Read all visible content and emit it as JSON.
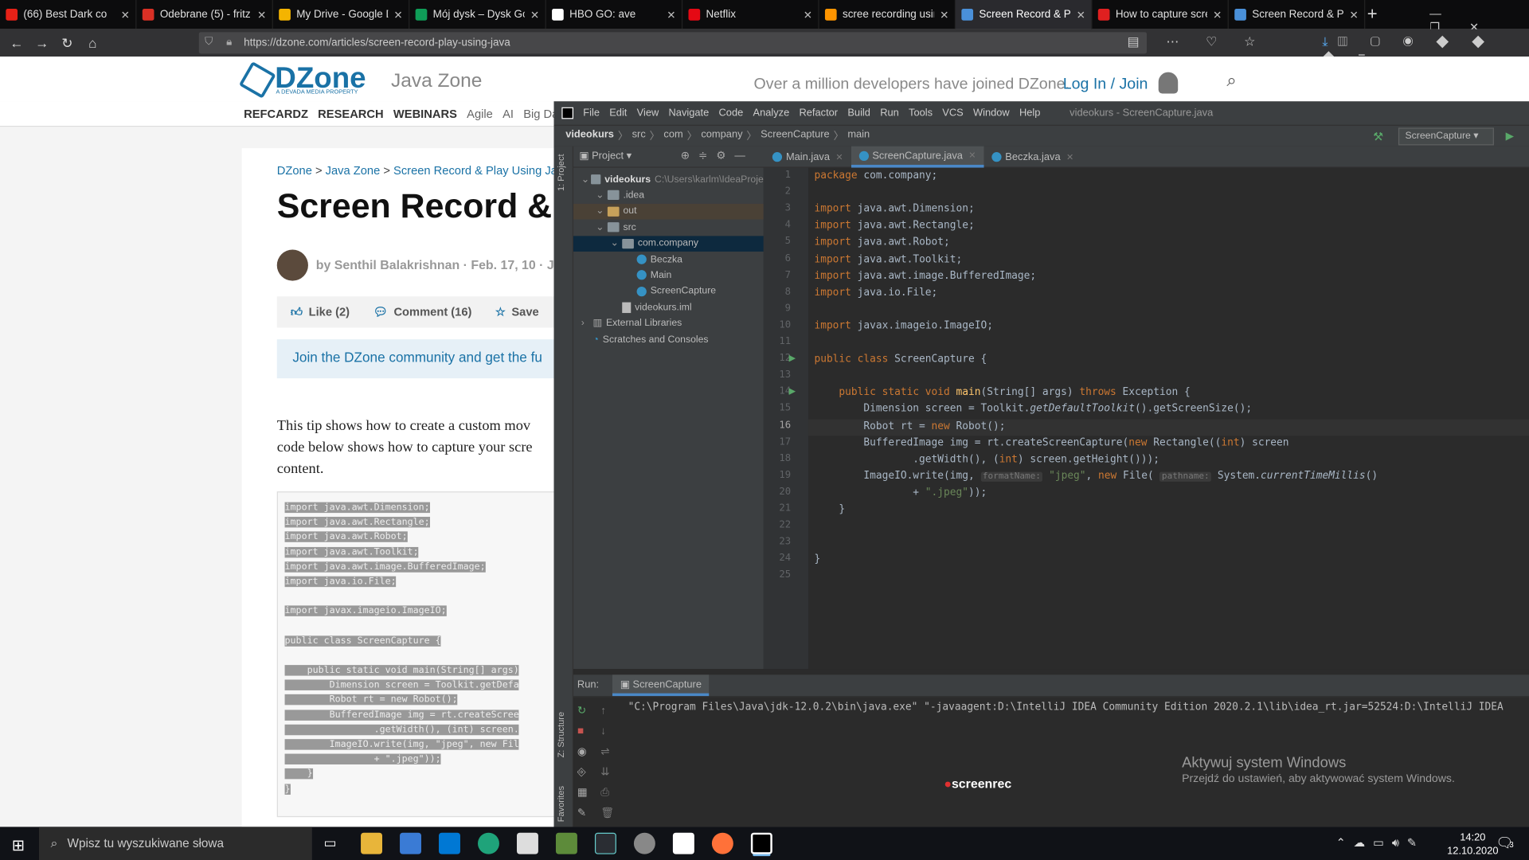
{
  "browser": {
    "tabs": [
      {
        "label": "(66) Best Dark co",
        "color": "#e62117"
      },
      {
        "label": "Odebrane (5) - fritz",
        "color": "#d93025"
      },
      {
        "label": "My Drive - Google D",
        "color": "#f4b400"
      },
      {
        "label": "Mój dysk – Dysk Goo",
        "color": "#0f9d58"
      },
      {
        "label": "HBO GO: ave",
        "color": "#ffffff"
      },
      {
        "label": "Netflix",
        "color": "#e50914"
      },
      {
        "label": "scree recording usin",
        "color": "#ff9500"
      },
      {
        "label": "Screen Record & Pla",
        "color": "#4a90d9"
      },
      {
        "label": "How to capture scre",
        "color": "#e02020"
      },
      {
        "label": "Screen Record & Pla",
        "color": "#4a90d9"
      }
    ],
    "url": "https://dzone.com/articles/screen-record-play-using-java"
  },
  "dzone": {
    "logo": "DZone",
    "tagline": "A DEVADA MEDIA PROPERTY",
    "zone": "Java Zone",
    "promo": "Over a million developers have joined DZone.",
    "login": "Log In / Join",
    "nav": [
      "REFCARDZ",
      "RESEARCH",
      "WEBINARS",
      "Agile",
      "AI",
      "Big Data"
    ],
    "breadcrumb": [
      "DZone",
      "Java Zone",
      "Screen Record & Play Using Java"
    ],
    "title": "Screen Record &",
    "byline": "by Senthil Balakrishnan · Feb. 17, 10 · J",
    "like": "Like (2)",
    "comment": "Comment (16)",
    "save": "Save",
    "join": "Join the DZone community and get the fu",
    "body": [
      "This tip shows how to create a custom mov",
      "code below shows how to capture your scre",
      "content."
    ],
    "snippet": [
      "import java.awt.Dimension;",
      "import java.awt.Rectangle;",
      "import java.awt.Robot;",
      "import java.awt.Toolkit;",
      "import java.awt.image.BufferedImage;",
      "import java.io.File;",
      "",
      "import javax.imageio.ImageIO;",
      "",
      "public class ScreenCapture {",
      "",
      "    public static void main(String[] args)",
      "        Dimension screen = Toolkit.getDefa",
      "        Robot rt = new Robot();",
      "        BufferedImage img = rt.createScree",
      "                .getWidth(), (int) screen.",
      "        ImageIO.write(img, \"jpeg\", new Fil",
      "                + \".jpeg\"));",
      "    }",
      "}"
    ]
  },
  "ide": {
    "menu": [
      "File",
      "Edit",
      "View",
      "Navigate",
      "Code",
      "Analyze",
      "Refactor",
      "Build",
      "Run",
      "Tools",
      "VCS",
      "Window",
      "Help"
    ],
    "window_title": "videokurs - ScreenCapture.java",
    "crumbs": [
      "videokurs",
      "src",
      "com",
      "company",
      "ScreenCapture",
      "main"
    ],
    "run_config": "ScreenCapture",
    "project_label": "Project",
    "tabs": [
      "Main.java",
      "ScreenCapture.java",
      "Beczka.java"
    ],
    "tree": [
      {
        "label": "videokurs",
        "extra": "C:\\Users\\karlm\\IdeaProje",
        "indent": 0
      },
      {
        "label": ".idea",
        "indent": 1
      },
      {
        "label": "out",
        "indent": 1
      },
      {
        "label": "src",
        "indent": 1
      },
      {
        "label": "com.company",
        "indent": 2
      },
      {
        "label": "Beczka",
        "indent": 3
      },
      {
        "label": "Main",
        "indent": 3
      },
      {
        "label": "ScreenCapture",
        "indent": 3
      },
      {
        "label": "videokurs.iml",
        "indent": 2
      },
      {
        "label": "External Libraries",
        "indent": 0
      },
      {
        "label": "Scratches and Consoles",
        "indent": 0
      }
    ],
    "line_numbers": [
      "1",
      "2",
      "3",
      "4",
      "5",
      "6",
      "7",
      "8",
      "9",
      "10",
      "11",
      "12",
      "13",
      "14",
      "15",
      "16",
      "17",
      "18",
      "19",
      "20",
      "21",
      "22",
      "23",
      "24",
      "25"
    ],
    "run_label": "Run:",
    "run_tab": "ScreenCapture",
    "console": "\"C:\\Program Files\\Java\\jdk-12.0.2\\bin\\java.exe\" \"-javaagent:D:\\IntelliJ IDEA Community Edition 2020.2.1\\lib\\idea_rt.jar=52524:D:\\IntelliJ IDEA",
    "side_left": "1: Project",
    "side_structure": "Z: Structure",
    "side_fav": "Favorites"
  },
  "watermark": {
    "title": "Aktywuj system Windows",
    "sub": "Przejdź do ustawień, aby aktywować system Windows."
  },
  "screenrec": "screenrec",
  "taskbar": {
    "search": "Wpisz tu wyszukiwane słowa",
    "time": "14:20",
    "date": "12.10.2020",
    "notif": "3"
  }
}
